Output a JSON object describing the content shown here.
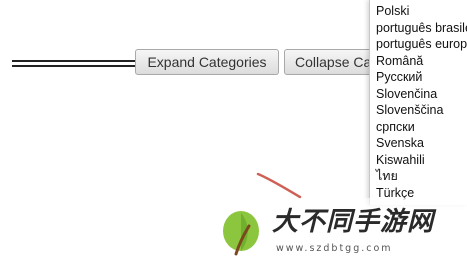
{
  "toolbar": {
    "expand_label": "Expand Categories",
    "collapse_label": "Collapse Ca"
  },
  "languages": [
    "Polski",
    "português brasileiro",
    "português europeu",
    "Română",
    "Русский",
    "Slovenčina",
    "Slovenščina",
    "српски",
    "Svenska",
    "Kiswahili",
    "ไทย",
    "Türkçe"
  ],
  "watermark": {
    "title": "大不同手游网",
    "url": "www.szdbtgg.com",
    "colors": {
      "leaf": "#8cc63f",
      "leaf_dark": "#5a9e1e",
      "stem": "#7a4a1e"
    }
  },
  "brush_color": "#c0392b"
}
